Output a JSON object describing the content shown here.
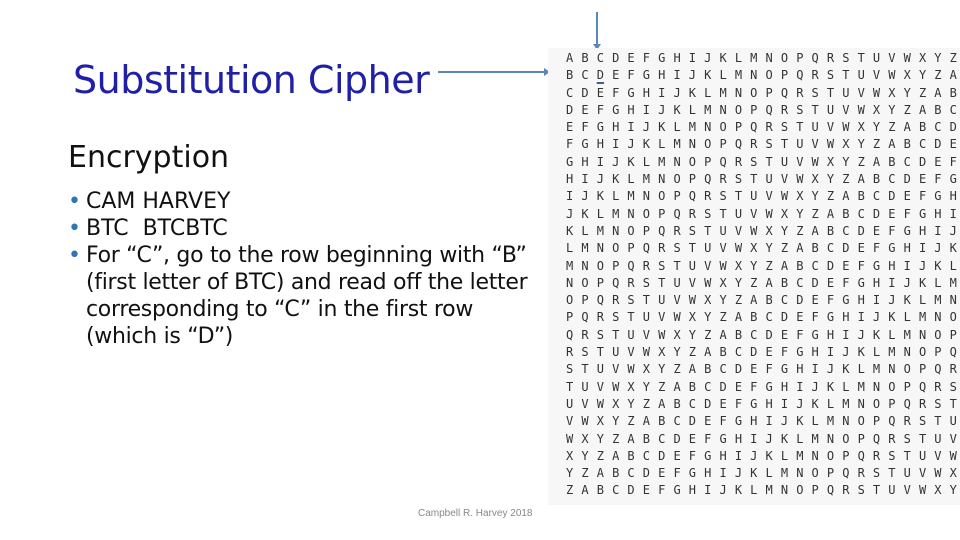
{
  "slide": {
    "title": "Substitution Cipher",
    "subtitle": "Encryption",
    "bullets": [
      "CAM HARVEY",
      "BTC  BTCBTC",
      "For “C”, go to the row beginning with “B” (first letter of BTC) and read off the letter corresponding to “C” in the first row (which is “D”)"
    ],
    "bullet_glyph": "•",
    "footer": "Campbell R. Harvey 2018"
  },
  "tabula_recta": {
    "alphabet": "ABCDEFGHIJKLMNOPQRSTUVWXYZ",
    "highlight": {
      "row_letter": "B",
      "column_letter": "C",
      "result": "D"
    },
    "colors": {
      "arrow": "#5b87b6",
      "title": "#1f1fa8",
      "bullet": "#2e75b6"
    }
  }
}
